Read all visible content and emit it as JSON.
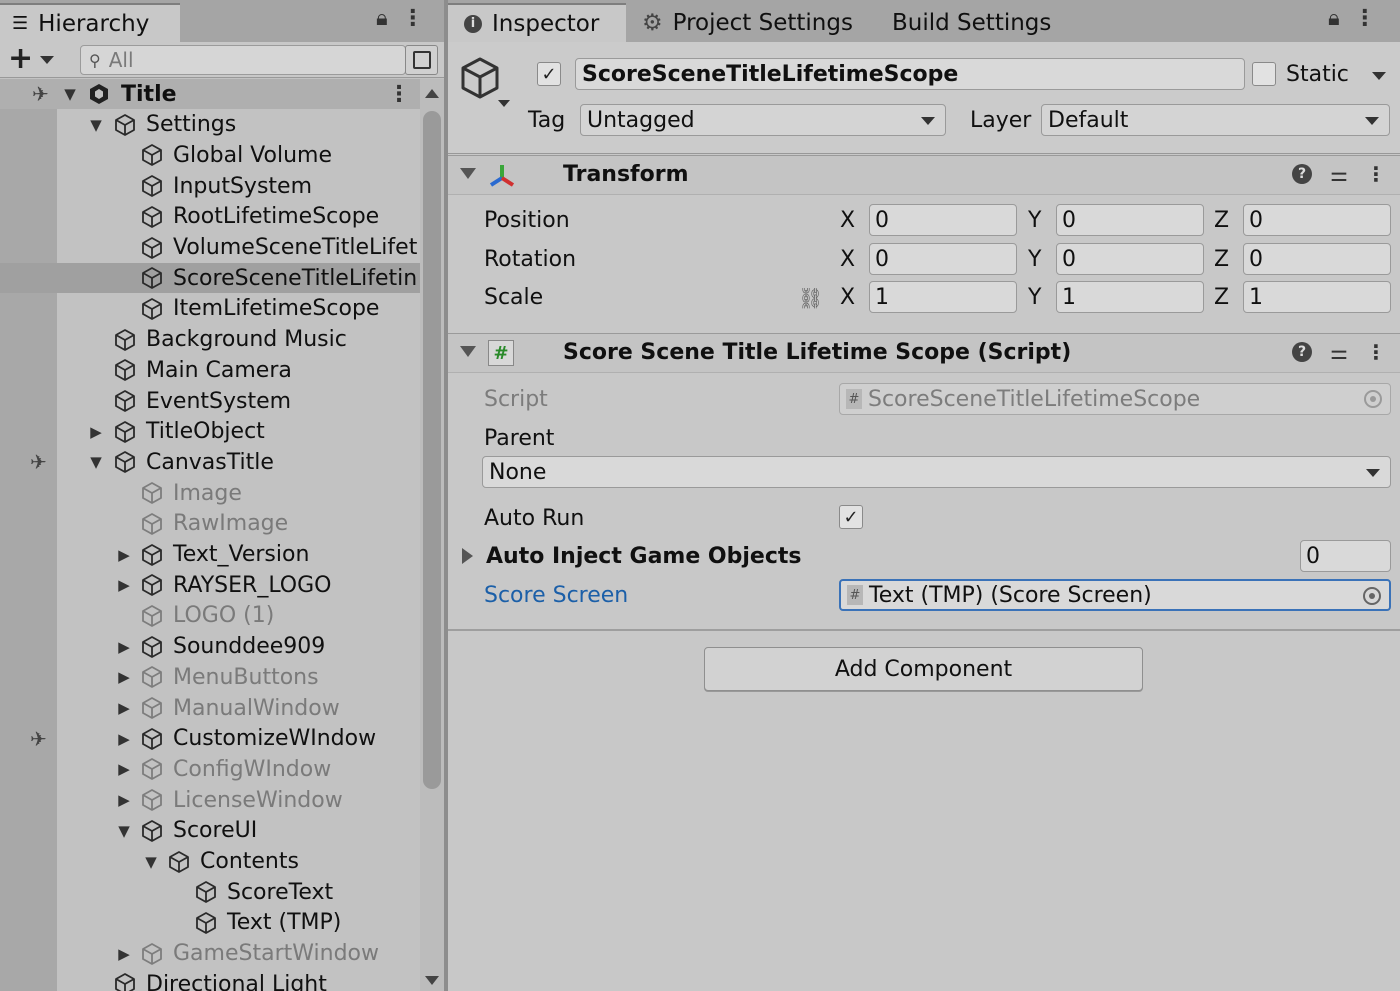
{
  "hierarchy": {
    "tab_label": "Hierarchy",
    "search_placeholder": "All",
    "scene_name": "Title",
    "items": [
      {
        "label": "Settings",
        "depth": 1,
        "arrow": "down",
        "dim": false
      },
      {
        "label": "Global Volume",
        "depth": 2,
        "arrow": "",
        "dim": false
      },
      {
        "label": "InputSystem",
        "depth": 2,
        "arrow": "",
        "dim": false
      },
      {
        "label": "RootLifetimeScope",
        "depth": 2,
        "arrow": "",
        "dim": false
      },
      {
        "label": "VolumeSceneTitleLifet",
        "depth": 2,
        "arrow": "",
        "dim": false
      },
      {
        "label": "ScoreSceneTitleLifetin",
        "depth": 2,
        "arrow": "",
        "dim": false,
        "selected": true
      },
      {
        "label": "ItemLifetimeScope",
        "depth": 2,
        "arrow": "",
        "dim": false
      },
      {
        "label": "Background Music",
        "depth": 1,
        "arrow": "",
        "dim": false
      },
      {
        "label": "Main Camera",
        "depth": 1,
        "arrow": "",
        "dim": false
      },
      {
        "label": "EventSystem",
        "depth": 1,
        "arrow": "",
        "dim": false
      },
      {
        "label": "TitleObject",
        "depth": 1,
        "arrow": "right",
        "dim": false
      },
      {
        "label": "CanvasTitle",
        "depth": 1,
        "arrow": "down",
        "dim": false,
        "gicon": true
      },
      {
        "label": "Image",
        "depth": 2,
        "arrow": "",
        "dim": true
      },
      {
        "label": "RawImage",
        "depth": 2,
        "arrow": "",
        "dim": true
      },
      {
        "label": "Text_Version",
        "depth": 2,
        "arrow": "right",
        "dim": false
      },
      {
        "label": "RAYSER_LOGO",
        "depth": 2,
        "arrow": "right",
        "dim": false
      },
      {
        "label": "LOGO (1)",
        "depth": 2,
        "arrow": "",
        "dim": true
      },
      {
        "label": "Sounddee909",
        "depth": 2,
        "arrow": "right",
        "dim": false
      },
      {
        "label": "MenuButtons",
        "depth": 2,
        "arrow": "right",
        "dim": true
      },
      {
        "label": "ManualWindow",
        "depth": 2,
        "arrow": "right",
        "dim": true
      },
      {
        "label": "CustomizeWIndow",
        "depth": 2,
        "arrow": "right",
        "dim": false,
        "gicon": true
      },
      {
        "label": "ConfigWIndow",
        "depth": 2,
        "arrow": "right",
        "dim": true
      },
      {
        "label": "LicenseWindow",
        "depth": 2,
        "arrow": "right",
        "dim": true
      },
      {
        "label": "ScoreUI",
        "depth": 2,
        "arrow": "down",
        "dim": false
      },
      {
        "label": "Contents",
        "depth": 3,
        "arrow": "down",
        "dim": false
      },
      {
        "label": "ScoreText",
        "depth": 4,
        "arrow": "",
        "dim": false
      },
      {
        "label": "Text (TMP)",
        "depth": 4,
        "arrow": "",
        "dim": false
      },
      {
        "label": "GameStartWindow",
        "depth": 2,
        "arrow": "right",
        "dim": true
      },
      {
        "label": "Directional Light",
        "depth": 1,
        "arrow": "",
        "dim": false
      }
    ]
  },
  "inspector": {
    "tabs": [
      "Inspector",
      "Project Settings",
      "Build Settings"
    ],
    "object_name": "ScoreSceneTitleLifetimeScope",
    "active": true,
    "static_label": "Static",
    "tag_label": "Tag",
    "tag_value": "Untagged",
    "layer_label": "Layer",
    "layer_value": "Default",
    "transform": {
      "title": "Transform",
      "position_label": "Position",
      "rotation_label": "Rotation",
      "scale_label": "Scale",
      "position": {
        "x": "0",
        "y": "0",
        "z": "0"
      },
      "rotation": {
        "x": "0",
        "y": "0",
        "z": "0"
      },
      "scale": {
        "x": "1",
        "y": "1",
        "z": "1"
      }
    },
    "script_component": {
      "title": "Score Scene Title Lifetime Scope (Script)",
      "script_label": "Script",
      "script_value": "ScoreSceneTitleLifetimeScope",
      "parent_label": "Parent",
      "parent_value": "None",
      "auto_run_label": "Auto Run",
      "auto_run": true,
      "auto_inject_label": "Auto Inject Game Objects",
      "auto_inject_count": "0",
      "score_screen_label": "Score Screen",
      "score_screen_value": "Text (TMP) (Score Screen)"
    },
    "add_component_label": "Add Component"
  },
  "axes": {
    "x": "X",
    "y": "Y",
    "z": "Z"
  },
  "colors": {
    "link_blue": "#1b5fa8",
    "selected_field_border": "#3a72b8"
  }
}
